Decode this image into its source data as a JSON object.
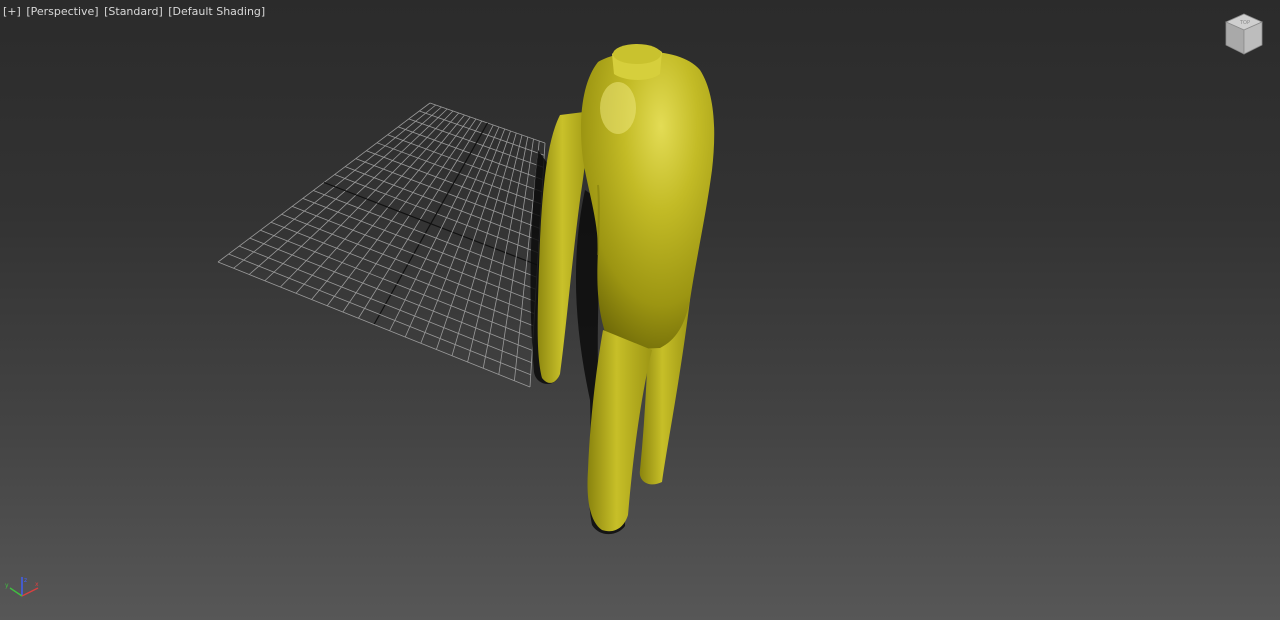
{
  "viewport": {
    "labels": {
      "plus_menu": "[+]",
      "view_menu": "[Perspective]",
      "standard_menu": "[Standard]",
      "shading_menu": "[Default Shading]"
    },
    "background_top": "#2b2b2b",
    "background_bottom": "#575757",
    "grid_color": "#9a9a9a",
    "grid_axis_color": "#111111",
    "model_color": "#b5ad1c"
  },
  "icons": {
    "viewcube": "viewcube-icon",
    "axis_tripod": "axis-tripod-icon"
  },
  "axis_colors": {
    "x": "#d84040",
    "y": "#40c040",
    "z": "#4060ff"
  }
}
